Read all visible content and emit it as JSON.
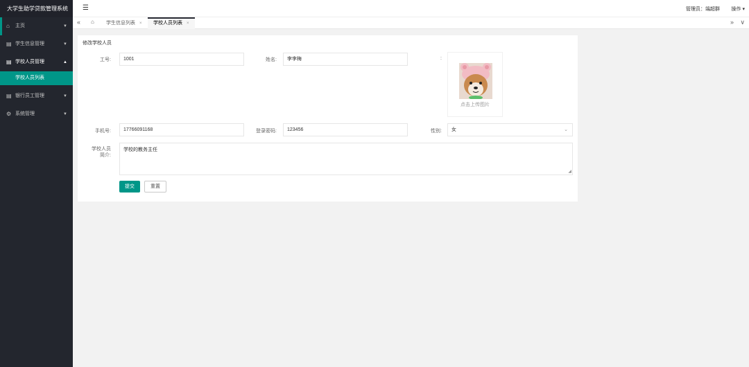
{
  "app": {
    "title": "大学生助学贷款管理系统"
  },
  "sidebar": {
    "items": [
      {
        "icon": "home-icon",
        "glyph": "⌂",
        "label": "主页",
        "arrow": "▼"
      },
      {
        "icon": "calendar-icon",
        "glyph": "▤",
        "label": "学生信息管理",
        "arrow": "▼"
      },
      {
        "icon": "calendar-icon",
        "glyph": "▤",
        "label": "学校人员管理",
        "arrow": "▲"
      },
      {
        "icon": "calendar-icon",
        "glyph": "▤",
        "label": "银行员工管理",
        "arrow": "▼"
      },
      {
        "icon": "gear-icon",
        "glyph": "⚙",
        "label": "系统管理",
        "arrow": "▼"
      }
    ],
    "sub_items": [
      {
        "label": "学校人员列表"
      }
    ]
  },
  "header": {
    "menu_glyph": "☰",
    "admin_label": "管理员：",
    "admin_name": "端超群",
    "ops_label": "操作 ▾"
  },
  "tabs": {
    "prev_glyph": "«",
    "home_glyph": "⌂",
    "next_glyph": "»",
    "more_glyph": "∨",
    "close_glyph": "×",
    "items": [
      {
        "label": "学生信息列表",
        "active": false
      },
      {
        "label": "学校人员列表",
        "active": true
      }
    ]
  },
  "form": {
    "title": "修改学校人员",
    "fields": {
      "employee_id": {
        "label": "工号:",
        "value": "1001"
      },
      "name": {
        "label": "姓名:",
        "value": "李李梅"
      },
      "photo": {
        "label": ":",
        "upload_text": "点击上传图片"
      },
      "phone": {
        "label": "手机号:",
        "value": "17766091168"
      },
      "password": {
        "label": "登录密码:",
        "value": "123456"
      },
      "gender": {
        "label": "性别:",
        "value": "女"
      },
      "intro": {
        "label": "学校人员简介:",
        "value": "学校的教务主任"
      }
    },
    "submit_label": "提交",
    "reset_label": "重置"
  },
  "colors": {
    "accent": "#009688",
    "sidebar_bg": "#23262e"
  }
}
